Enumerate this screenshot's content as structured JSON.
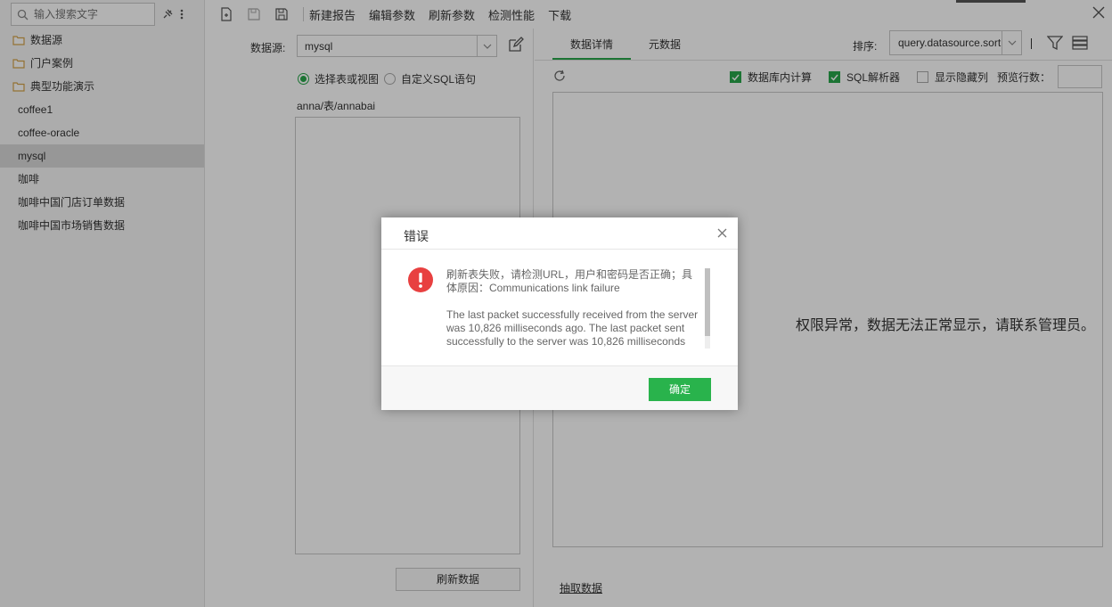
{
  "sidebar": {
    "search_placeholder": "输入搜索文字",
    "tree": [
      {
        "label": "数据源",
        "type": "folder"
      },
      {
        "label": "门户案例",
        "type": "folder"
      },
      {
        "label": "典型功能演示",
        "type": "folder"
      },
      {
        "label": "coffee1",
        "type": "item"
      },
      {
        "label": "coffee-oracle",
        "type": "item"
      },
      {
        "label": "mysql",
        "type": "item",
        "selected": true
      },
      {
        "label": "咖啡",
        "type": "item"
      },
      {
        "label": "咖啡中国门店订单数据",
        "type": "item"
      },
      {
        "label": "咖啡中国市场销售数据",
        "type": "item"
      }
    ]
  },
  "toolbar": {
    "new_report": "新建报告",
    "edit_params": "编辑参数",
    "refresh_params": "刷新参数",
    "check_perf": "检测性能",
    "download": "下载"
  },
  "center": {
    "datasource_label": "数据源:",
    "datasource_value": "mysql",
    "radio_table": "选择表或视图",
    "radio_sql": "自定义SQL语句",
    "path": "anna/表/annabai",
    "refresh_button": "刷新数据"
  },
  "right": {
    "tabs": [
      "数据详情",
      "元数据"
    ],
    "sort_label": "排序:",
    "sort_value": "query.datasource.sort.",
    "opt_db_compute": "数据库内计算",
    "opt_sql_parser": "SQL解析器",
    "opt_show_hidden": "显示隐藏列",
    "preview_rows_label": "预览行数：",
    "permission_message": "权限异常，数据无法正常显示，请联系管理员。",
    "extract_link": "抽取数据"
  },
  "dialog": {
    "title": "错误",
    "message_1": "刷新表失败，请检测URL，用户和密码是否正确；具体原因：Communications link failure",
    "message_2": "The last packet successfully received from the server was 10,826 milliseconds ago.  The last packet sent successfully to the server was 10,826 milliseconds",
    "ok_button": "确定"
  },
  "colors": {
    "accent_green": "#29b34c",
    "error_red": "#e84040",
    "folder_orange": "#d4a24a"
  },
  "icons": [
    "search-icon",
    "pin-icon",
    "more-icon",
    "folder-icon",
    "new-report-icon",
    "save-icon",
    "save-as-icon",
    "close-icon",
    "edit-icon",
    "reload-icon",
    "filter-icon",
    "rows-icon",
    "error-icon"
  ]
}
